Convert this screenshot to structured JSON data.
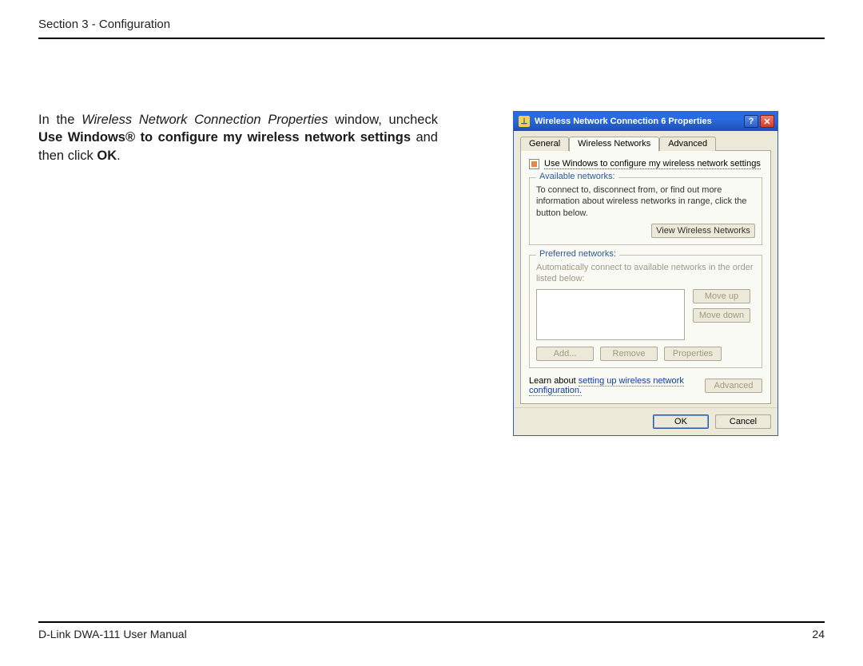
{
  "header": {
    "section": "Section 3 - Configuration"
  },
  "instruction": {
    "part1": "In the ",
    "italic": "Wireless Network Connection Properties",
    "part2": " window, uncheck ",
    "bold": "Use Windows® to configure my wireless network settings",
    "part3": " and then click ",
    "bold2": "OK",
    "part4": "."
  },
  "dialog": {
    "title": "Wireless Network Connection 6 Properties",
    "tabs": {
      "general": "General",
      "wireless": "Wireless Networks",
      "advanced": "Advanced"
    },
    "checkbox_label": "Use Windows to configure my wireless network settings",
    "checkbox_underline_key": "U",
    "available": {
      "label": "Available networks:",
      "label_key": "n",
      "help": "To connect to, disconnect from, or find out more information about wireless networks in range, click the button below.",
      "button": "View Wireless Networks"
    },
    "preferred": {
      "label": "Preferred networks:",
      "label_key": "P",
      "help": "Automatically connect to available networks in the order listed below:",
      "move_up": "Move up",
      "move_up_key": "u",
      "move_down": "Move down",
      "move_down_key": "d",
      "add": "Add...",
      "add_key": "A",
      "remove": "Remove",
      "remove_key": "R",
      "properties": "Properties",
      "properties_key": "o"
    },
    "learn_prefix": "Learn about ",
    "learn_link": "setting up wireless network configuration.",
    "advanced_btn": "Advanced",
    "advanced_btn_key": "v",
    "ok": "OK",
    "cancel": "Cancel"
  },
  "footer": {
    "manual": "D-Link DWA-111 User Manual",
    "page": "24"
  }
}
